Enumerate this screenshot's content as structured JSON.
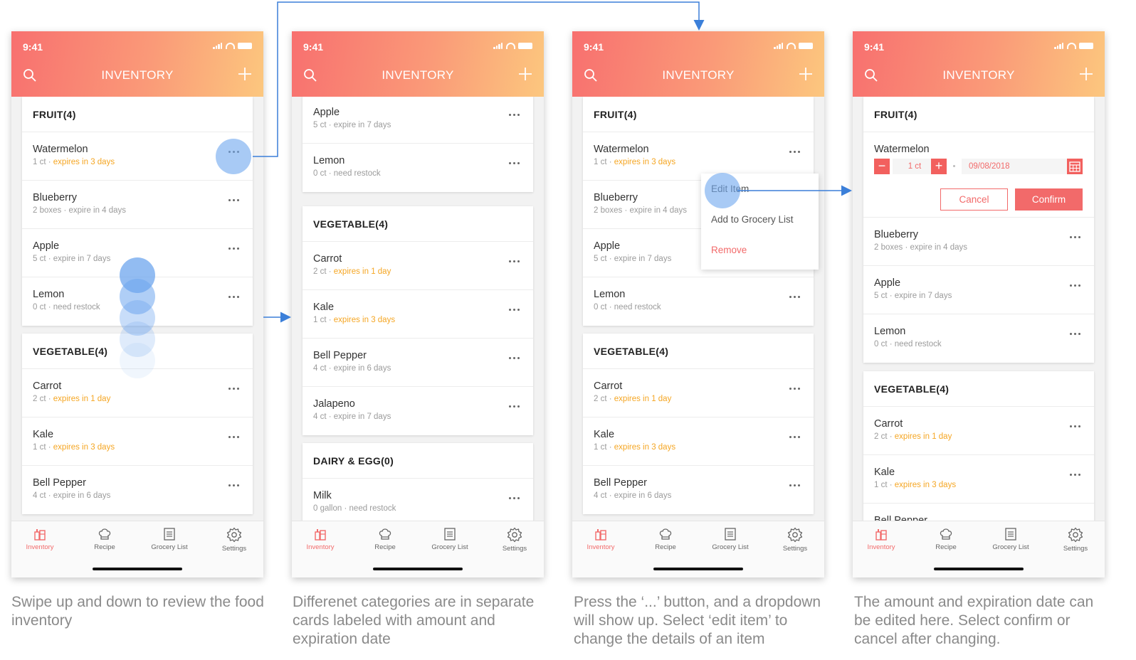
{
  "colors": {
    "accent": "#f26a6a",
    "expiring": "#f5a623",
    "arrow": "#3b7fd9",
    "touch": "#6ea6ee"
  },
  "app": {
    "status_time": "9:41",
    "title": "INVENTORY",
    "tabs": [
      {
        "label": "Inventory",
        "icon": "inventory-icon",
        "active": true
      },
      {
        "label": "Recipe",
        "icon": "chef-hat-icon",
        "active": false
      },
      {
        "label": "Grocery List",
        "icon": "list-icon",
        "active": false
      },
      {
        "label": "Settings",
        "icon": "gear-icon",
        "active": false
      }
    ]
  },
  "screens": [
    {
      "cards": [
        {
          "header": "FRUIT(4)",
          "items": [
            {
              "name": "Watermelon",
              "amount": "1 ct",
              "sep": " · ",
              "expiry": "expires in 3 days",
              "expiring": true
            },
            {
              "name": "Blueberry",
              "amount": "2 boxes",
              "sep": " · ",
              "expiry": "expire in 4 days",
              "expiring": false
            },
            {
              "name": "Apple",
              "amount": "5 ct",
              "sep": " · ",
              "expiry": "expire in 7 days",
              "expiring": false
            },
            {
              "name": "Lemon",
              "amount": "0 ct",
              "sep": " · ",
              "expiry": "need restock",
              "expiring": false
            }
          ]
        },
        {
          "header": "VEGETABLE(4)",
          "items": [
            {
              "name": "Carrot",
              "amount": "2 ct",
              "sep": " · ",
              "expiry": "expires in 1 day",
              "expiring": true
            },
            {
              "name": "Kale",
              "amount": "1 ct",
              "sep": " · ",
              "expiry": "expires in 3 days",
              "expiring": true
            },
            {
              "name": "Bell Pepper",
              "amount": "4 ct",
              "sep": " · ",
              "expiry": "expire in 6 days",
              "expiring": false
            }
          ]
        }
      ]
    },
    {
      "cards": [
        {
          "header": "",
          "items": [
            {
              "name": "Apple",
              "amount": "5 ct",
              "sep": " · ",
              "expiry": "expire in 7 days",
              "expiring": false
            },
            {
              "name": "Lemon",
              "amount": "0 ct",
              "sep": " · ",
              "expiry": "need restock",
              "expiring": false
            }
          ]
        },
        {
          "header": "VEGETABLE(4)",
          "items": [
            {
              "name": "Carrot",
              "amount": "2 ct",
              "sep": " · ",
              "expiry": "expires in 1 day",
              "expiring": true
            },
            {
              "name": "Kale",
              "amount": "1 ct",
              "sep": " · ",
              "expiry": "expires in 3 days",
              "expiring": true
            },
            {
              "name": "Bell Pepper",
              "amount": "4 ct",
              "sep": " · ",
              "expiry": "expire in 6 days",
              "expiring": false
            },
            {
              "name": "Jalapeno",
              "amount": "4 ct",
              "sep": " · ",
              "expiry": "expire in 7 days",
              "expiring": false
            }
          ]
        },
        {
          "header": "DAIRY & EGG(0)",
          "items": [
            {
              "name": "Milk",
              "amount": "0 gallon",
              "sep": " · ",
              "expiry": "need restock",
              "expiring": false
            }
          ]
        }
      ]
    },
    {
      "cards": [
        {
          "header": "FRUIT(4)",
          "items": [
            {
              "name": "Watermelon",
              "amount": "1 ct",
              "sep": " · ",
              "expiry": "expires in 3 days",
              "expiring": true
            },
            {
              "name": "Blueberry",
              "amount": "2 boxes",
              "sep": " · ",
              "expiry": "expire in 4 days",
              "expiring": false
            },
            {
              "name": "Apple",
              "amount": "5 ct",
              "sep": " · ",
              "expiry": "expire in 7 days",
              "expiring": false
            },
            {
              "name": "Lemon",
              "amount": "0 ct",
              "sep": " · ",
              "expiry": "need restock",
              "expiring": false
            }
          ]
        },
        {
          "header": "VEGETABLE(4)",
          "items": [
            {
              "name": "Carrot",
              "amount": "2 ct",
              "sep": " · ",
              "expiry": "expires in 1 day",
              "expiring": true
            },
            {
              "name": "Kale",
              "amount": "1 ct",
              "sep": " · ",
              "expiry": "expires in 3 days",
              "expiring": true
            },
            {
              "name": "Bell Pepper",
              "amount": "4 ct",
              "sep": " · ",
              "expiry": "expire in 6 days",
              "expiring": false
            }
          ]
        }
      ],
      "dropdown": {
        "edit": "Edit Item",
        "add": "Add to Grocery List",
        "remove": "Remove"
      }
    },
    {
      "editing": {
        "header": "FRUIT(4)",
        "name": "Watermelon",
        "minus": "−",
        "plus": "+",
        "quantity": "1 ct",
        "date": "09/08/2018",
        "cancel": "Cancel",
        "confirm": "Confirm"
      },
      "cards": [
        {
          "header": "",
          "items": [
            {
              "name": "Blueberry",
              "amount": "2 boxes",
              "sep": " · ",
              "expiry": "expire in 4 days",
              "expiring": false
            },
            {
              "name": "Apple",
              "amount": "5 ct",
              "sep": " · ",
              "expiry": "expire in 7 days",
              "expiring": false
            },
            {
              "name": "Lemon",
              "amount": "0 ct",
              "sep": " · ",
              "expiry": "need restock",
              "expiring": false
            }
          ]
        },
        {
          "header": "VEGETABLE(4)",
          "items": [
            {
              "name": "Carrot",
              "amount": "2 ct",
              "sep": " · ",
              "expiry": "expires in 1 day",
              "expiring": true
            },
            {
              "name": "Kale",
              "amount": "1 ct",
              "sep": " · ",
              "expiry": "expires in 3 days",
              "expiring": true
            },
            {
              "name": "Bell Pepper",
              "amount": "",
              "sep": "",
              "expiry": "",
              "expiring": false
            }
          ]
        }
      ]
    }
  ],
  "captions": [
    "Swipe up and down to review the food inventory",
    "Differenet categories are in separate cards labeled with amount and expiration date",
    "Press the ‘...’ button, and a dropdown will show up. Select ‘edit item’ to change the details of an item",
    "The amount and expiration date can be edited here. Select confirm or cancel after changing."
  ]
}
